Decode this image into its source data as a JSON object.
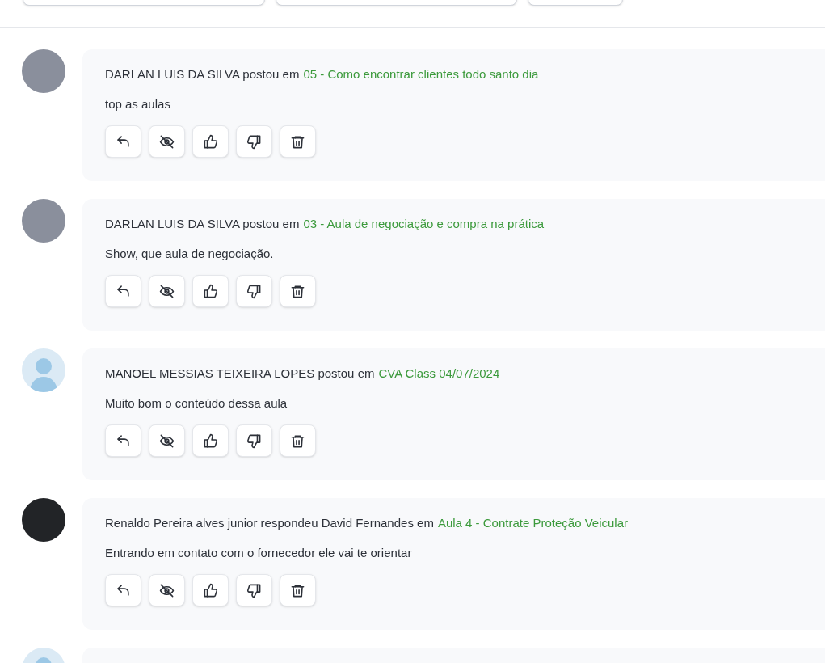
{
  "filters": [
    {
      "kind": "field"
    },
    {
      "kind": "field"
    },
    {
      "kind": "field"
    }
  ],
  "posts": [
    {
      "kind": "photo",
      "byline": "DARLAN LUIS DA SILVA postou em",
      "topic": "05 - Como encontrar clientes todo santo dia",
      "body": "top as aulas"
    },
    {
      "kind": "photo",
      "byline": "DARLAN LUIS DA SILVA postou em",
      "topic": "03 - Aula de negociação e compra na prática",
      "body": "Show, que aula de negociação."
    },
    {
      "kind": "default",
      "byline": "MANOEL MESSIAS TEIXEIRA LOPES postou em",
      "topic": "CVA Class 04/07/2024",
      "body": "Muito bom o conteúdo dessa aula"
    },
    {
      "kind": "dark",
      "byline": "Renaldo Pereira alves junior respondeu David Fernandes em",
      "topic": "Aula 4 - Contrate Proteção Veicular",
      "body": "Entrando em contato com o fornecedor ele vai te orientar"
    },
    {
      "kind": "default"
    }
  ]
}
